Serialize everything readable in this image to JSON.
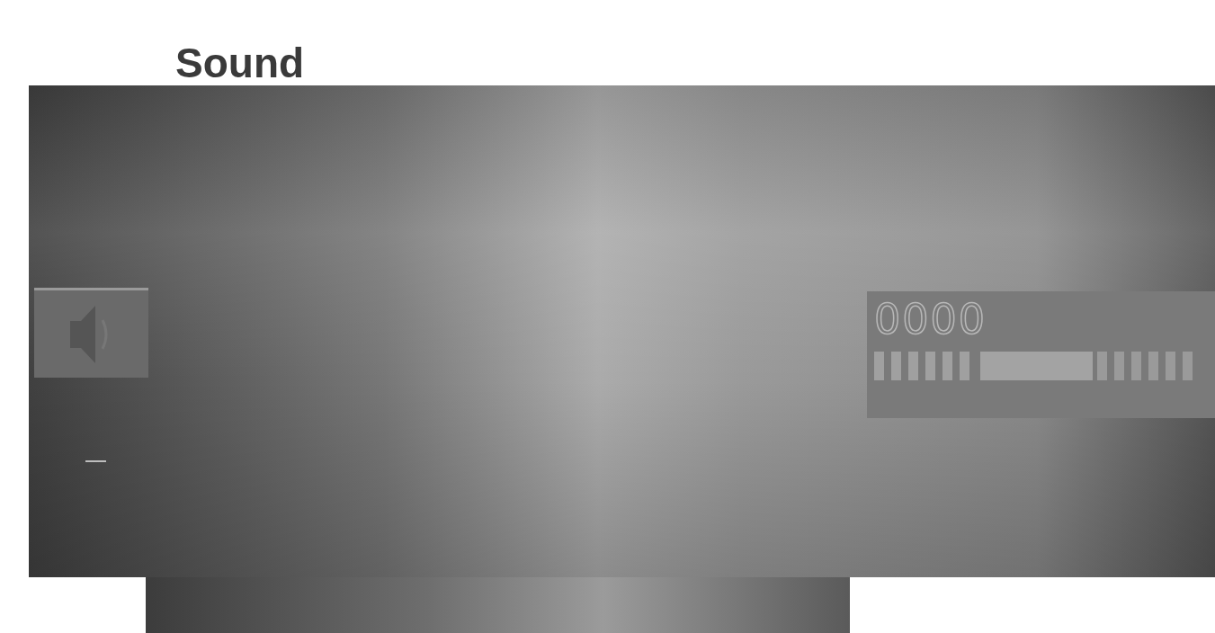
{
  "heading": "Sound",
  "display": {
    "counter": "0000"
  }
}
